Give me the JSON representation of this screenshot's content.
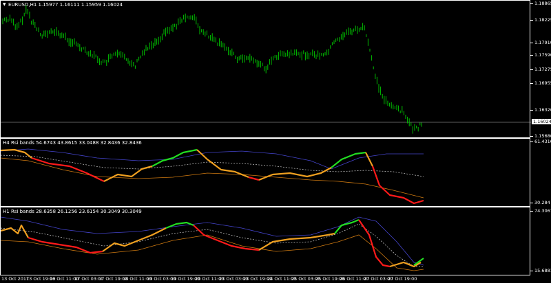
{
  "main_chart": {
    "title": "EURUSD,H1  1.15977 1.16111 1.15959 1.16024",
    "price_axis": [
      "1.18865",
      "1.18225",
      "1.17910",
      "1.17590",
      "1.17275",
      "1.16955",
      "1.16320",
      "1.15680"
    ],
    "current_price": "1.16024"
  },
  "rsi_h4": {
    "title": "H4 Rsi bands 54.6743 43.8615 33.0488 32.8436 32.8436",
    "axis_top": "61.4316",
    "axis_bottom": "30.284"
  },
  "rsi_h1": {
    "title": "H1 Rsi bands 28.6358 26.1256 23.6154 30.3049 30.3049",
    "axis_top": "74.3067",
    "axis_bottom": "15.6881"
  },
  "time_axis": [
    "13 Oct 2017",
    "13 Oct 19:00",
    "16 Oct 11:00",
    "17 Oct 03:00",
    "17 Oct 19:00",
    "18 Oct 11:00",
    "19 Oct 03:00",
    "19 Oct 19:00",
    "20 Oct 11:00",
    "23 Oct 03:00",
    "23 Oct 19:00",
    "24 Oct 11:00",
    "25 Oct 03:00",
    "25 Oct 19:00",
    "26 Oct 11:00",
    "27 Oct 03:00",
    "27 Oct 19:00"
  ],
  "colors": {
    "candles": "#00c000",
    "rsi_up": "#22dd22",
    "rsi_mid": "#f0a020",
    "rsi_down": "#ff1a1a",
    "band_upper": "#4444cc",
    "band_lower": "#d07a10",
    "band_mid": "#cccccc"
  }
}
